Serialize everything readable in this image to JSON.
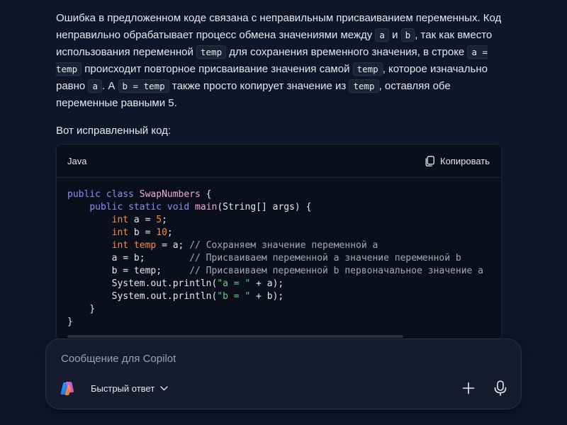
{
  "answer": {
    "p1": {
      "t1": "Ошибка в предложенном коде связана с неправильным присваиванием переменных. Код неправильно обрабатывает процесс обмена значениями между ",
      "c1": "a",
      "t2": " и ",
      "c2": "b",
      "t3": ", так как вместо использования переменной ",
      "c3": "temp",
      "t4": " для сохранения временного значения, в строке ",
      "c4": "a = temp",
      "t5": " происходит повторное присваивание значения самой ",
      "c5": "temp",
      "t6": ", которое изначально равно ",
      "c6": "a",
      "t7": ". А ",
      "c7": "b = temp",
      "t8": " также просто копирует значение из ",
      "c8": "temp",
      "t9": ", оставляя обе переменные равными 5."
    },
    "p2": "Вот исправленный код:"
  },
  "code_block": {
    "language": "Java",
    "copy_label": "Копировать",
    "lines": [
      [
        {
          "t": "public",
          "c": "kw"
        },
        {
          "t": " "
        },
        {
          "t": "class",
          "c": "kw"
        },
        {
          "t": " "
        },
        {
          "t": "SwapNumbers",
          "c": "cls"
        },
        {
          "t": " {"
        }
      ],
      [
        {
          "t": "    "
        },
        {
          "t": "public",
          "c": "kw"
        },
        {
          "t": " "
        },
        {
          "t": "static",
          "c": "kw"
        },
        {
          "t": " "
        },
        {
          "t": "void",
          "c": "kw"
        },
        {
          "t": " "
        },
        {
          "t": "main",
          "c": "fn"
        },
        {
          "t": "(String[] args) {"
        }
      ],
      [
        {
          "t": "        "
        },
        {
          "t": "int",
          "c": "tp"
        },
        {
          "t": " a = "
        },
        {
          "t": "5",
          "c": "num"
        },
        {
          "t": ";"
        }
      ],
      [
        {
          "t": "        "
        },
        {
          "t": "int",
          "c": "tp"
        },
        {
          "t": " b = "
        },
        {
          "t": "10",
          "c": "num"
        },
        {
          "t": ";"
        }
      ],
      [
        {
          "t": "        "
        },
        {
          "t": "int",
          "c": "tp"
        },
        {
          "t": " "
        },
        {
          "t": "temp",
          "c": "tp"
        },
        {
          "t": " = a; "
        },
        {
          "t": "// Сохраняем значение переменной a",
          "c": "cm"
        }
      ],
      [
        {
          "t": "        a = b;        "
        },
        {
          "t": "// Присваиваем переменной a значение переменной b",
          "c": "cm"
        }
      ],
      [
        {
          "t": "        b = temp;     "
        },
        {
          "t": "// Присваиваем переменной b первоначальное значение a",
          "c": "cm"
        }
      ],
      [
        {
          "t": "        System.out.println("
        },
        {
          "t": "\"a = \"",
          "c": "str"
        },
        {
          "t": " + a);"
        }
      ],
      [
        {
          "t": "        System.out.println("
        },
        {
          "t": "\"b = \"",
          "c": "str"
        },
        {
          "t": " + b);"
        }
      ],
      [
        {
          "t": "    }"
        }
      ],
      [
        {
          "t": "}"
        }
      ]
    ]
  },
  "composer": {
    "placeholder": "Сообщение для Copilot",
    "mode_label": "Быстрый ответ"
  },
  "icons": {
    "copy": "copy-icon",
    "logo": "copilot-logo-icon",
    "chevron": "chevron-down-icon",
    "plus": "plus-icon",
    "mic": "microphone-icon"
  },
  "colors": {
    "background": "#0f1629",
    "code_background": "#0b0f1c",
    "keyword": "#8f8cf6",
    "type_number": "#f58b3f",
    "class_function": "#f1a6e0",
    "string": "#6ccb8a",
    "comment": "#a5a8b2"
  }
}
